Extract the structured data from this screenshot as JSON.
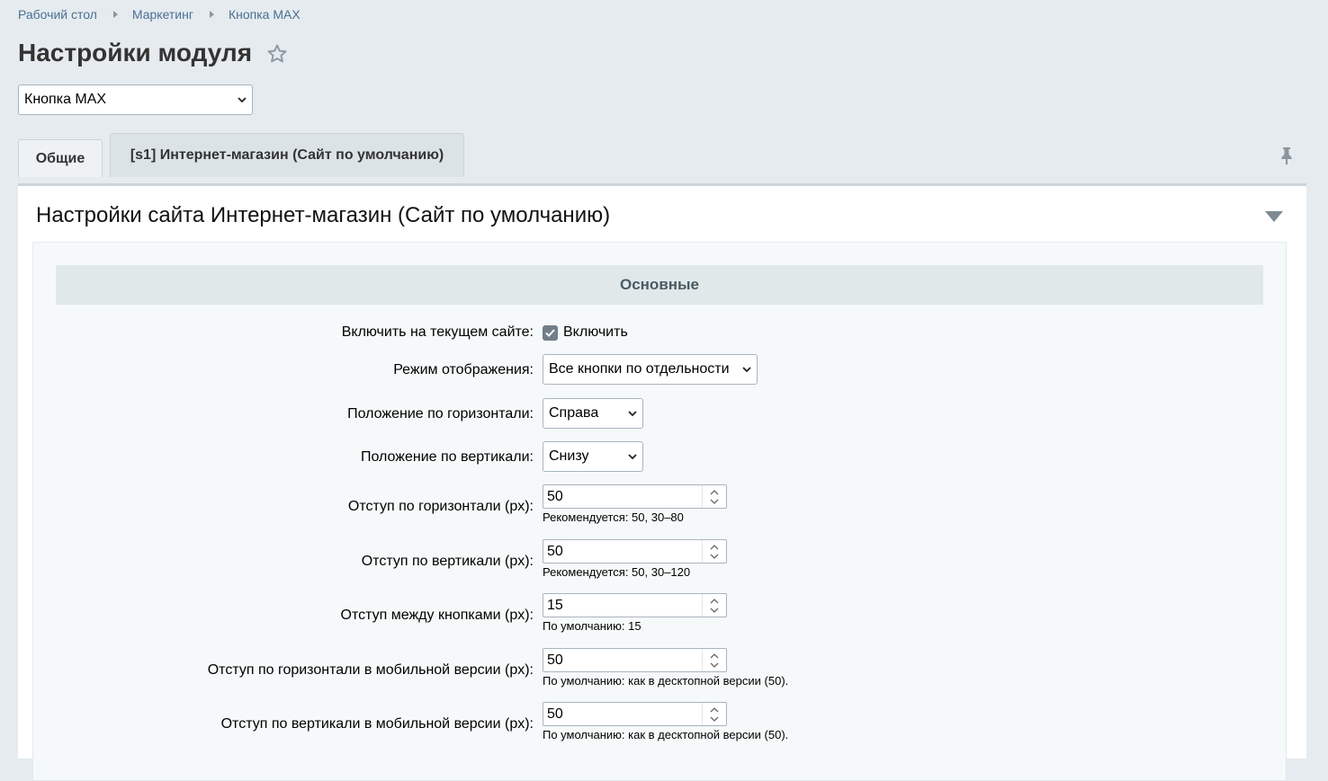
{
  "breadcrumb": {
    "items": [
      "Рабочий стол",
      "Маркетинг",
      "Кнопка MAX"
    ]
  },
  "header": {
    "title": "Настройки модуля",
    "module_select": "Кнопка MAX"
  },
  "tabs": [
    {
      "label": "Общие"
    },
    {
      "label": "[s1] Интернет-магазин (Сайт по умолчанию)"
    }
  ],
  "section": {
    "title": "Настройки сайта Интернет-магазин (Сайт по умолчанию)",
    "group_title": "Основные"
  },
  "fields": {
    "enable": {
      "label": "Включить на текущем сайте:",
      "checkbox_label": "Включить",
      "checked": true
    },
    "display_mode": {
      "label": "Режим отображения:",
      "value": "Все кнопки по отдельности"
    },
    "pos_horizontal": {
      "label": "Положение по горизонтали:",
      "value": "Справа"
    },
    "pos_vertical": {
      "label": "Положение по вертикали:",
      "value": "Снизу"
    },
    "offset_h": {
      "label": "Отступ по горизонтали (px):",
      "value": "50",
      "hint": "Рекомендуется: 50, 30–80"
    },
    "offset_v": {
      "label": "Отступ по вертикали (px):",
      "value": "50",
      "hint": "Рекомендуется: 50, 30–120"
    },
    "gap": {
      "label": "Отступ между кнопками (px):",
      "value": "15",
      "hint": "По умолчанию: 15"
    },
    "offset_h_mobile": {
      "label": "Отступ по горизонтали в мобильной версии (px):",
      "value": "50",
      "hint": "По умолчанию: как в десктопной версии (50)."
    },
    "offset_v_mobile": {
      "label": "Отступ по вертикали в мобильной версии (px):",
      "value": "50",
      "hint": "По умолчанию: как в десктопной версии (50)."
    }
  },
  "icons": {
    "star": "star-outline-icon",
    "pin": "pin-icon",
    "collapse": "triangle-down-icon"
  }
}
